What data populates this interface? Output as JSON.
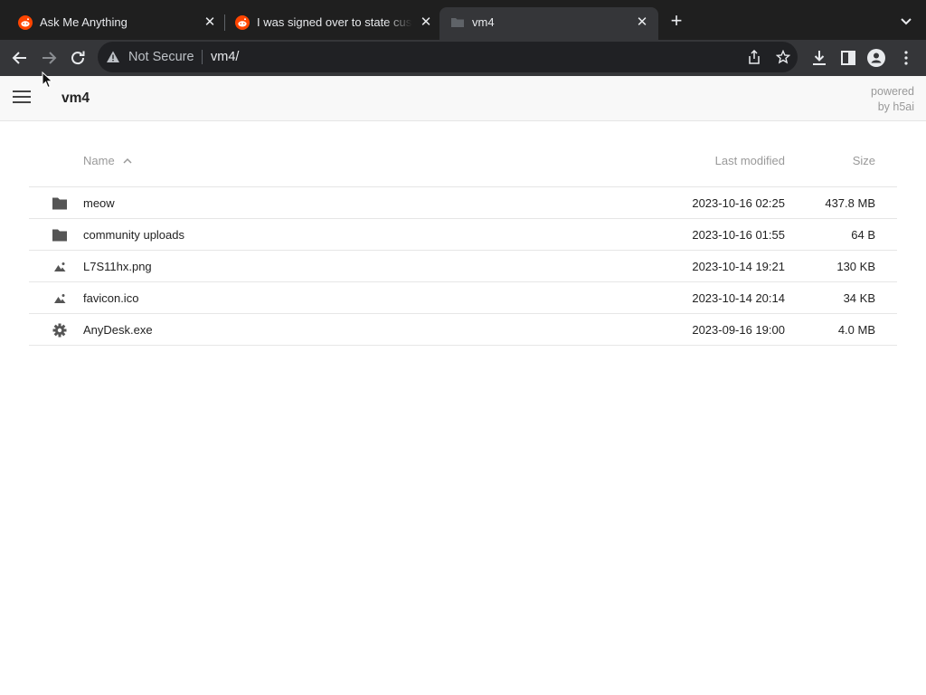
{
  "browser": {
    "tabs": [
      {
        "title": "Ask Me Anything",
        "favicon": "reddit-icon",
        "active": false
      },
      {
        "title": "I was signed over to state custody",
        "favicon": "reddit-icon",
        "active": false
      },
      {
        "title": "vm4",
        "favicon": "folder-icon",
        "active": true
      }
    ],
    "new_tab": "+",
    "close_glyph": "✕"
  },
  "toolbar": {
    "security_text": "Not Secure",
    "url": "vm4/"
  },
  "page": {
    "title": "vm4",
    "powered_line1": "powered",
    "powered_line2": "by h5ai"
  },
  "listing": {
    "columns": {
      "name": "Name",
      "modified": "Last modified",
      "size": "Size"
    },
    "sort_indicator": "chevron-up-icon",
    "rows": [
      {
        "icon": "folder-icon",
        "name": "meow",
        "modified": "2023-10-16 02:25",
        "size": "437.8 MB"
      },
      {
        "icon": "folder-icon",
        "name": "community uploads",
        "modified": "2023-10-16 01:55",
        "size": "64 B"
      },
      {
        "icon": "image-icon",
        "name": "L7S11hx.png",
        "modified": "2023-10-14 19:21",
        "size": "130 KB"
      },
      {
        "icon": "image-icon",
        "name": "favicon.ico",
        "modified": "2023-10-14 20:14",
        "size": "34 KB"
      },
      {
        "icon": "gear-icon",
        "name": "AnyDesk.exe",
        "modified": "2023-09-16 19:00",
        "size": "4.0 MB"
      }
    ]
  },
  "colors": {
    "reddit": "#ff4500",
    "tabstrip": "#1f1f1f",
    "toolbar": "#353639",
    "omnibox": "#202124"
  }
}
